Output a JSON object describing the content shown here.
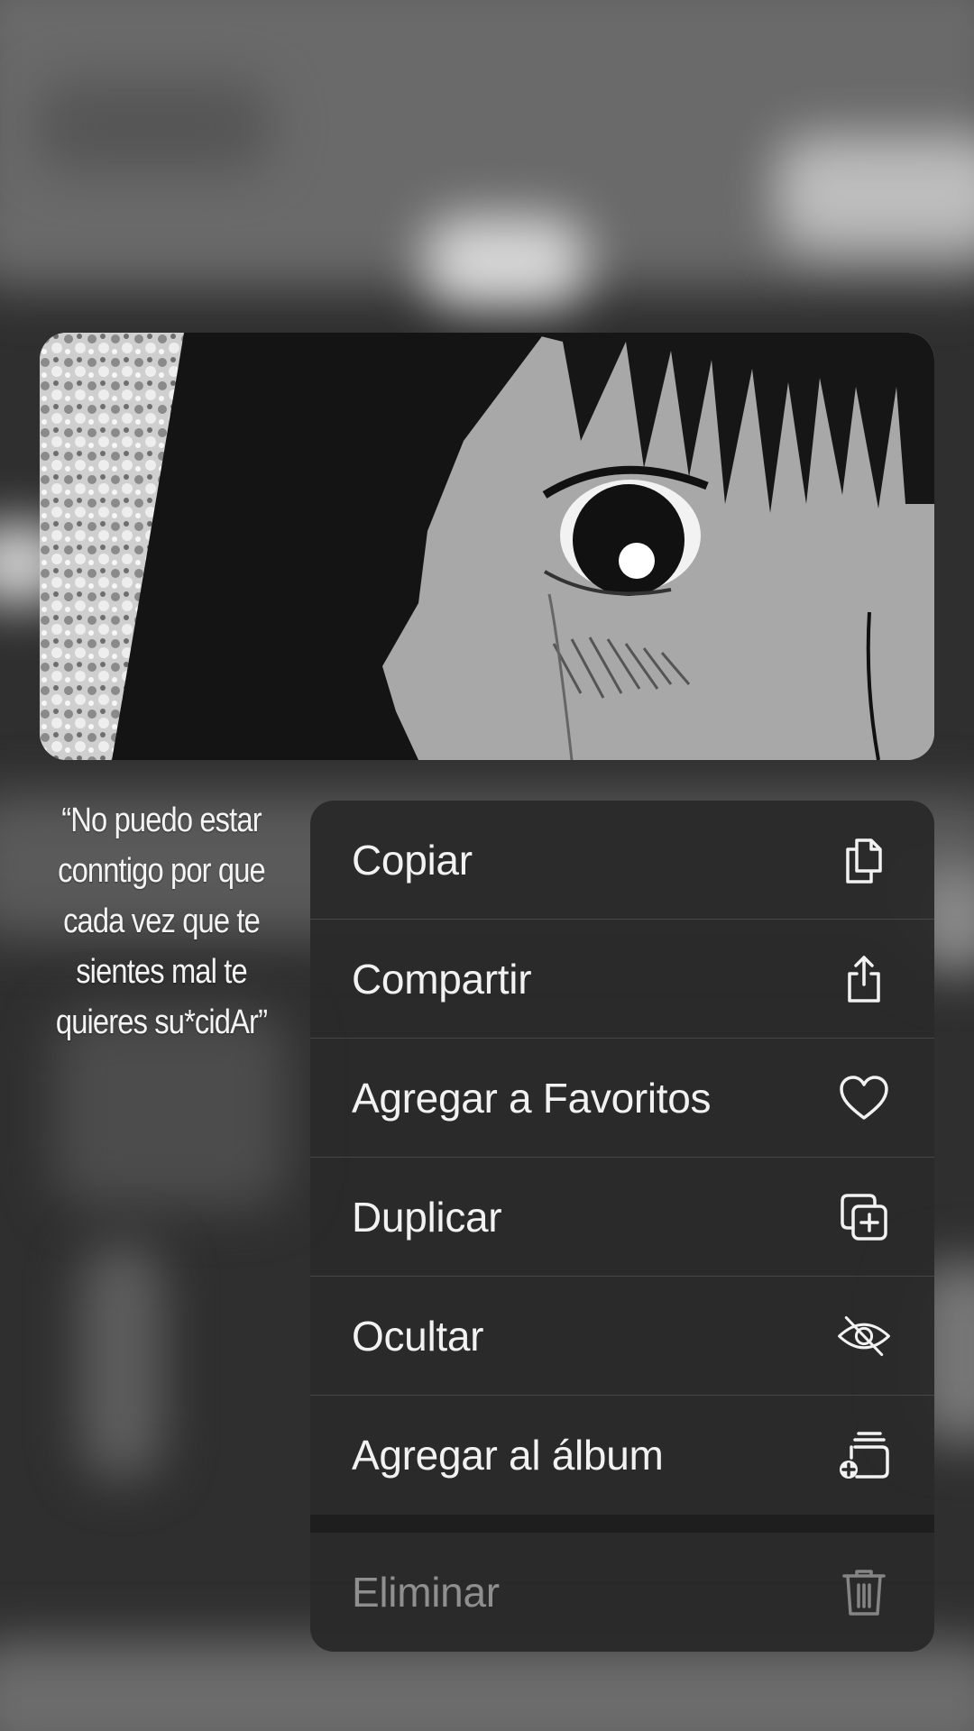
{
  "caption": {
    "text": "“No puedo estar conntigo por que cada vez que te sientes mal te quieres su*cidAr”"
  },
  "menu": {
    "items": [
      {
        "label": "Copiar",
        "icon": "copy-icon"
      },
      {
        "label": "Compartir",
        "icon": "share-icon"
      },
      {
        "label": "Agregar a Favoritos",
        "icon": "heart-icon"
      },
      {
        "label": "Duplicar",
        "icon": "duplicate-icon"
      },
      {
        "label": "Ocultar",
        "icon": "eye-slash-icon"
      },
      {
        "label": "Agregar al álbum",
        "icon": "add-to-album-icon"
      }
    ],
    "destructive": {
      "label": "Eliminar",
      "icon": "trash-icon",
      "disabled": true
    }
  },
  "colors": {
    "menu_background": "#2a2a2a",
    "menu_text": "#f2f2f2",
    "disabled_text": "#8f8f8f"
  }
}
